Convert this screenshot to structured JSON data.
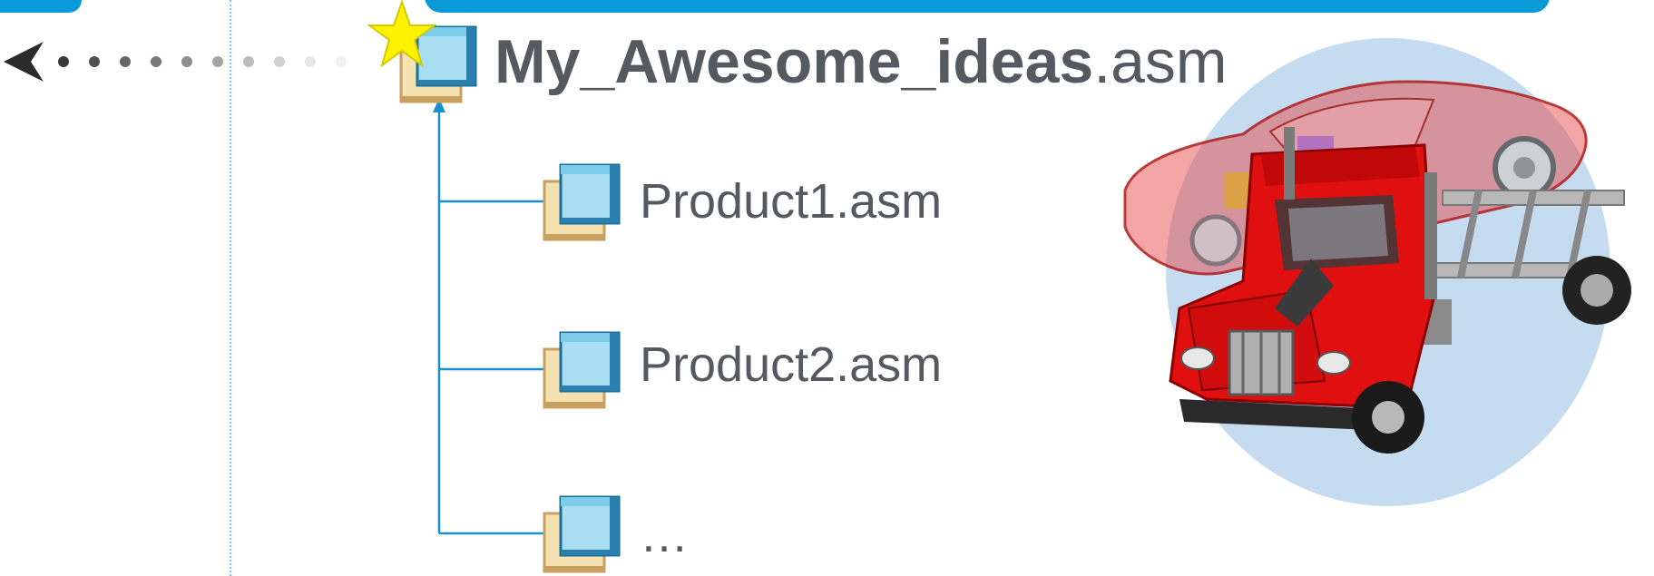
{
  "tree": {
    "root": {
      "name_bold": "My_Awesome_ideas",
      "name_ext": ".asm",
      "badge": "star-icon"
    },
    "children": [
      {
        "label": "Product1.asm",
        "icon": "assembly-icon"
      },
      {
        "label": "Product2.asm",
        "icon": "assembly-icon"
      },
      {
        "label": "…",
        "icon": "assembly-icon"
      }
    ]
  },
  "colors": {
    "accent_blue": "#0a9ad8",
    "tree_line": "#1a8fd0",
    "text": "#555a60",
    "star": "#fff200",
    "truck_red": "#e01010",
    "circle_bg": "#c5dcf0"
  },
  "illustration": {
    "subject": "car-and-truck-3d-model"
  }
}
